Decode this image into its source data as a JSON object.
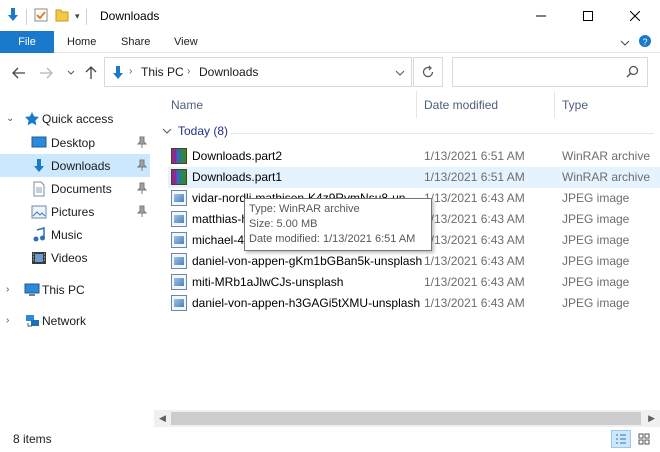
{
  "window": {
    "title": "Downloads"
  },
  "ribbon": {
    "tabs": [
      {
        "label": "File",
        "active": true
      },
      {
        "label": "Home"
      },
      {
        "label": "Share"
      },
      {
        "label": "View"
      }
    ]
  },
  "address": {
    "crumbs": [
      "This PC",
      "Downloads"
    ]
  },
  "search": {
    "placeholder": ""
  },
  "nav_pane": {
    "quick_access": "Quick access",
    "items": [
      {
        "label": "Desktop",
        "icon": "desktop-icon",
        "pinned": true
      },
      {
        "label": "Downloads",
        "icon": "downloads-icon",
        "pinned": true,
        "selected": true
      },
      {
        "label": "Documents",
        "icon": "documents-icon",
        "pinned": true
      },
      {
        "label": "Pictures",
        "icon": "pictures-icon",
        "pinned": true
      },
      {
        "label": "Music",
        "icon": "music-icon"
      },
      {
        "label": "Videos",
        "icon": "videos-icon"
      }
    ],
    "this_pc": "This PC",
    "network": "Network"
  },
  "file_list": {
    "columns": [
      "Name",
      "Date modified",
      "Type"
    ],
    "group": "Today (8)",
    "files": [
      {
        "name": "Downloads.part2",
        "date": "1/13/2021 6:51 AM",
        "type": "WinRAR archive",
        "icon": "winrar-icon"
      },
      {
        "name": "Downloads.part1",
        "date": "1/13/2021 6:51 AM",
        "type": "WinRAR archive",
        "icon": "winrar-icon",
        "hover": true
      },
      {
        "name": "vidar-nordli-mathisen-K4z9RvmNsu8-un",
        "date": "1/13/2021 6:43 AM",
        "type": "JPEG image",
        "icon": "jpeg-icon"
      },
      {
        "name": "matthias-h",
        "date": "1/13/2021 6:43 AM",
        "type": "JPEG image",
        "icon": "jpeg-icon"
      },
      {
        "name": "michael-4",
        "date": "1/13/2021 6:43 AM",
        "type": "JPEG image",
        "icon": "jpeg-icon"
      },
      {
        "name": "daniel-von-appen-gKm1bGBan5k-unsplash",
        "date": "1/13/2021 6:43 AM",
        "type": "JPEG image",
        "icon": "jpeg-icon"
      },
      {
        "name": "miti-MRb1aJlwCJs-unsplash",
        "date": "1/13/2021 6:43 AM",
        "type": "JPEG image",
        "icon": "jpeg-icon"
      },
      {
        "name": "daniel-von-appen-h3GAGi5tXMU-unsplash",
        "date": "1/13/2021 6:43 AM",
        "type": "JPEG image",
        "icon": "jpeg-icon"
      }
    ]
  },
  "tooltip": {
    "type": "Type: WinRAR archive",
    "size": "Size: 5.00 MB",
    "date": "Date modified: 1/13/2021 6:51 AM"
  },
  "status": {
    "count": "8 items"
  },
  "colors": {
    "accent": "#1979ca",
    "selection": "#cce8ff",
    "hover": "#e5f3ff",
    "group_text": "#1e3287"
  }
}
